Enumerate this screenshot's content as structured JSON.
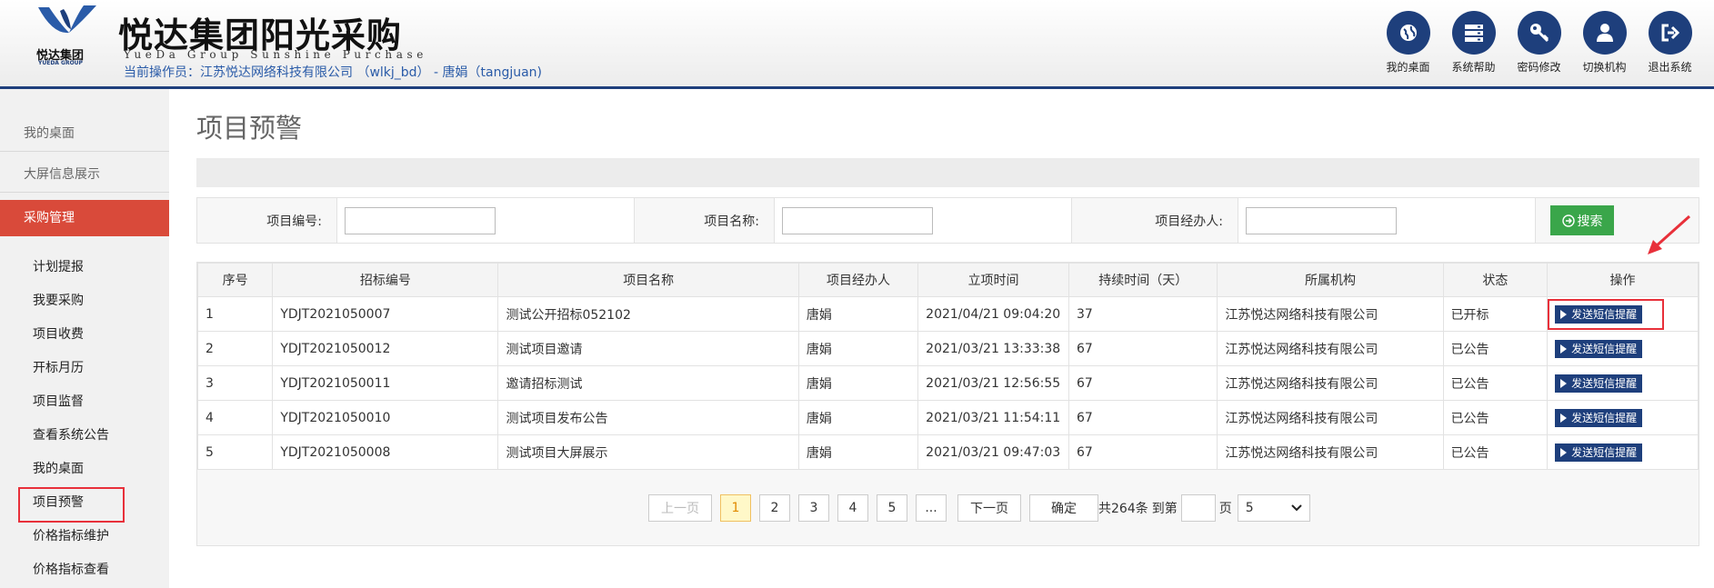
{
  "header": {
    "logo_text": "悦达集团",
    "logo_sub": "YUEDA GROUP",
    "title": "悦达集团阳光采购",
    "subtitle": "YueDa Group Sunshine Purchase",
    "operator": "当前操作员：江苏悦达网络科技有限公司 （wlkj_bd） - 唐娟（tangjuan)",
    "brand_color": "#1e3f7c",
    "nav": [
      {
        "label": "我的桌面",
        "icon": "globe-icon"
      },
      {
        "label": "系统帮助",
        "icon": "server-icon"
      },
      {
        "label": "密码修改",
        "icon": "key-icon"
      },
      {
        "label": "切换机构",
        "icon": "user-icon"
      },
      {
        "label": "退出系统",
        "icon": "logout-icon"
      }
    ]
  },
  "sidebar": {
    "top_items": [
      "我的桌面",
      "大屏信息展示"
    ],
    "active_group": "采购管理",
    "sub_items": [
      "计划提报",
      "我要采购",
      "项目收费",
      "开标月历",
      "项目监督",
      "查看系统公告",
      "我的桌面",
      "项目预警",
      "价格指标维护",
      "价格指标查看"
    ],
    "highlighted": "项目预警"
  },
  "main": {
    "title": "项目预警",
    "search": {
      "project_no_label": "项目编号:",
      "project_name_label": "项目名称:",
      "manager_label": "项目经办人:",
      "project_no_value": "",
      "project_name_value": "",
      "manager_value": "",
      "button_label": "搜索"
    },
    "table": {
      "headers": [
        "序号",
        "招标编号",
        "项目名称",
        "项目经办人",
        "立项时间",
        "持续时间（天）",
        "所属机构",
        "状态",
        "操作"
      ],
      "rows": [
        {
          "no": "1",
          "code": "YDJT2021050007",
          "name": "测试公开招标052102",
          "manager": "唐娟",
          "time": "2021/04/21 09:04:20",
          "days": "37",
          "org": "江苏悦达网络科技有限公司",
          "status": "已开标",
          "action": "发送短信提醒"
        },
        {
          "no": "2",
          "code": "YDJT2021050012",
          "name": "测试项目邀请",
          "manager": "唐娟",
          "time": "2021/03/21 13:33:38",
          "days": "67",
          "org": "江苏悦达网络科技有限公司",
          "status": "已公告",
          "action": "发送短信提醒"
        },
        {
          "no": "3",
          "code": "YDJT2021050011",
          "name": "邀请招标测试",
          "manager": "唐娟",
          "time": "2021/03/21 12:56:55",
          "days": "67",
          "org": "江苏悦达网络科技有限公司",
          "status": "已公告",
          "action": "发送短信提醒"
        },
        {
          "no": "4",
          "code": "YDJT2021050010",
          "name": "测试项目发布公告",
          "manager": "唐娟",
          "time": "2021/03/21 11:54:11",
          "days": "67",
          "org": "江苏悦达网络科技有限公司",
          "status": "已公告",
          "action": "发送短信提醒"
        },
        {
          "no": "5",
          "code": "YDJT2021050008",
          "name": "测试项目大屏展示",
          "manager": "唐娟",
          "time": "2021/03/21 09:47:03",
          "days": "67",
          "org": "江苏悦达网络科技有限公司",
          "status": "已公告",
          "action": "发送短信提醒"
        }
      ]
    },
    "pager": {
      "prev": "上一页",
      "pages": [
        "1",
        "2",
        "3",
        "4",
        "5",
        "..."
      ],
      "current": "1",
      "next": "下一页",
      "confirm": "确定",
      "total": "共264条",
      "goto": "到第",
      "page_unit": "页",
      "page_size": "5"
    }
  }
}
